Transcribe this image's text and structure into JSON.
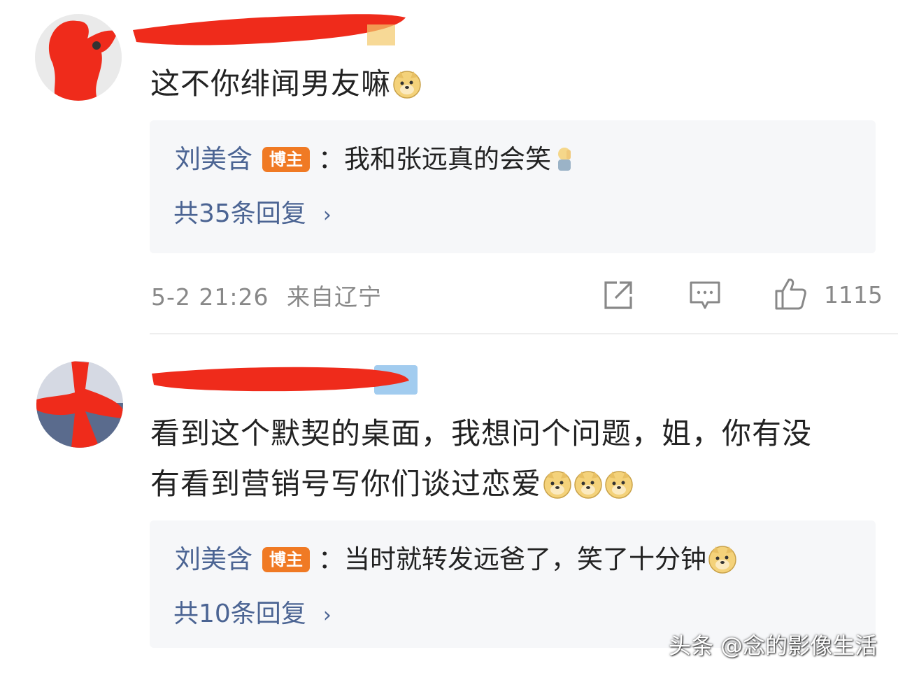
{
  "comments": [
    {
      "text": "这不你绯闻男友嘛",
      "emoji_count": 1,
      "reply": {
        "author": "刘美含",
        "badge": "博主",
        "separator": "：",
        "text": "我和张远真的会笑",
        "count_label": "共35条回复",
        "chevron": "›"
      },
      "meta": {
        "time": "5-2 21:26",
        "location": "来自辽宁"
      },
      "actions": {
        "share_icon": "share-icon",
        "comment_icon": "comment-icon",
        "like_icon": "like-icon",
        "likes": "1115"
      }
    },
    {
      "text_line1": "看到这个默契的桌面，我想问个问题，姐，你有没",
      "text_line2": "有看到营销号写你们谈过恋爱",
      "emoji_count": 3,
      "reply": {
        "author": "刘美含",
        "badge": "博主",
        "separator": "：",
        "text": "当时就转发远爸了，笑了十分钟",
        "count_label": "共10条回复",
        "chevron": "›"
      }
    }
  ],
  "watermark": "头条 @念的影像生活",
  "colors": {
    "link": "#4b6493",
    "badge": "#f07a24",
    "redaction": "#ef2b1b",
    "meta": "#888888"
  }
}
